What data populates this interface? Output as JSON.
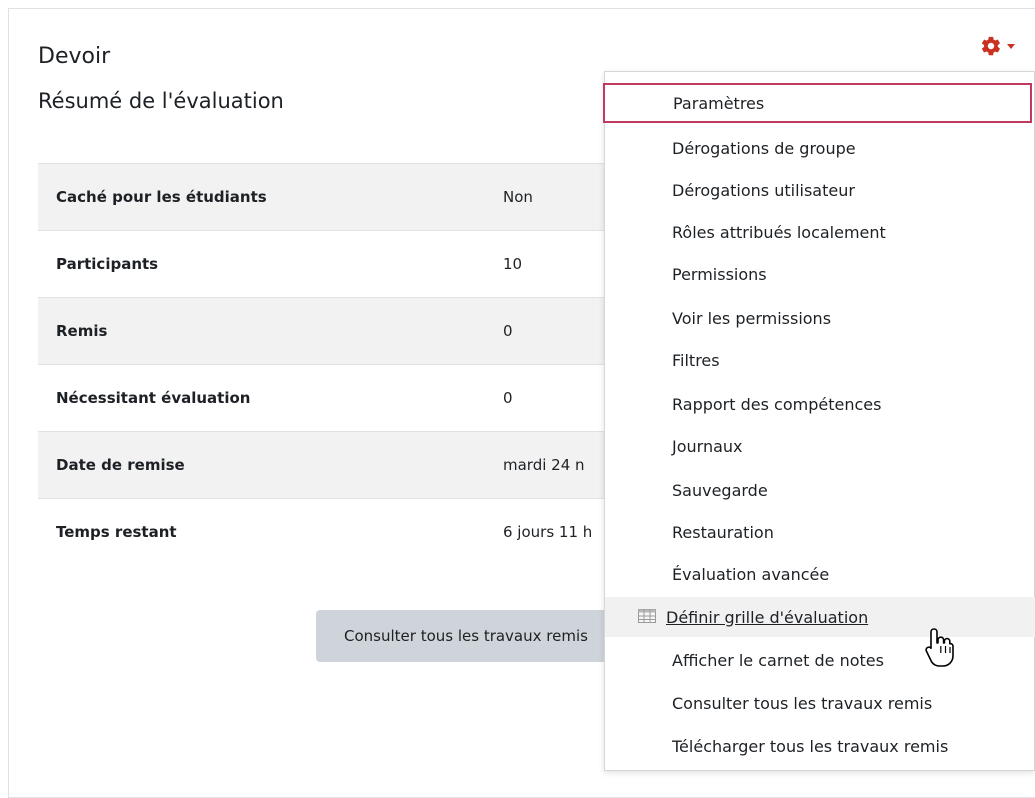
{
  "page": {
    "title": "Devoir",
    "subtitle": "Résumé de l'évaluation"
  },
  "summary": {
    "rows": [
      {
        "label": "Caché pour les étudiants",
        "value": "Non"
      },
      {
        "label": "Participants",
        "value": "10"
      },
      {
        "label": "Remis",
        "value": "0"
      },
      {
        "label": "Nécessitant évaluation",
        "value": "0"
      },
      {
        "label": "Date de remise",
        "value": "mardi 24 n"
      },
      {
        "label": "Temps restant",
        "value": "6 jours 11 h"
      }
    ]
  },
  "buttons": {
    "view_all": "Consulter tous les travaux remis"
  },
  "menu": {
    "items": [
      {
        "label": "Paramètres"
      },
      {
        "label": "Dérogations de groupe"
      },
      {
        "label": "Dérogations utilisateur"
      },
      {
        "label": "Rôles attribués localement"
      },
      {
        "label": "Permissions"
      },
      {
        "label": "Voir les permissions"
      },
      {
        "label": "Filtres"
      },
      {
        "label": "Rapport des compétences"
      },
      {
        "label": "Journaux"
      },
      {
        "label": "Sauvegarde"
      },
      {
        "label": "Restauration"
      },
      {
        "label": "Évaluation avancée"
      },
      {
        "label": "Définir grille d'évaluation"
      },
      {
        "label": "Afficher le carnet de notes"
      },
      {
        "label": "Consulter tous les travaux remis"
      },
      {
        "label": "Télécharger tous les travaux remis"
      }
    ]
  },
  "icons": {
    "settings": "gear-icon",
    "grid": "grid-icon",
    "cursor": "hand-cursor-icon"
  },
  "colors": {
    "accent": "#ca3120",
    "focus_border": "#c0395e"
  }
}
